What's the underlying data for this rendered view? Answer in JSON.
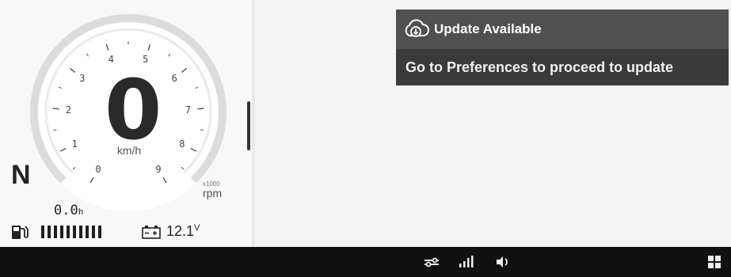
{
  "speedometer": {
    "speed": "0",
    "speed_unit": "km/h",
    "gear": "N",
    "rpm_multiplier": "x1000",
    "rpm_unit": "rpm",
    "rpm_ticks": [
      "0",
      "1",
      "2",
      "3",
      "4",
      "5",
      "6",
      "7",
      "8",
      "9"
    ]
  },
  "trip": {
    "value": "0.0",
    "unit": "h"
  },
  "fuel": {
    "level": 1.0,
    "segments": 10,
    "icon": "fuel-pump-icon"
  },
  "battery": {
    "value": "12.1",
    "unit": "V",
    "icon": "battery-icon"
  },
  "notification": {
    "title": "Update Available",
    "message": "Go to Preferences to proceed to update",
    "icon": "cloud-download-icon"
  },
  "bottom_bar": {
    "icons": [
      "connection-icon",
      "signal-strength-icon",
      "volume-icon",
      "grid-menu-icon"
    ]
  },
  "colors": {
    "background": "#f6f6f6",
    "notification_header": "#505050",
    "notification_body": "#3a3a3a",
    "bottom_bar": "#111111"
  }
}
